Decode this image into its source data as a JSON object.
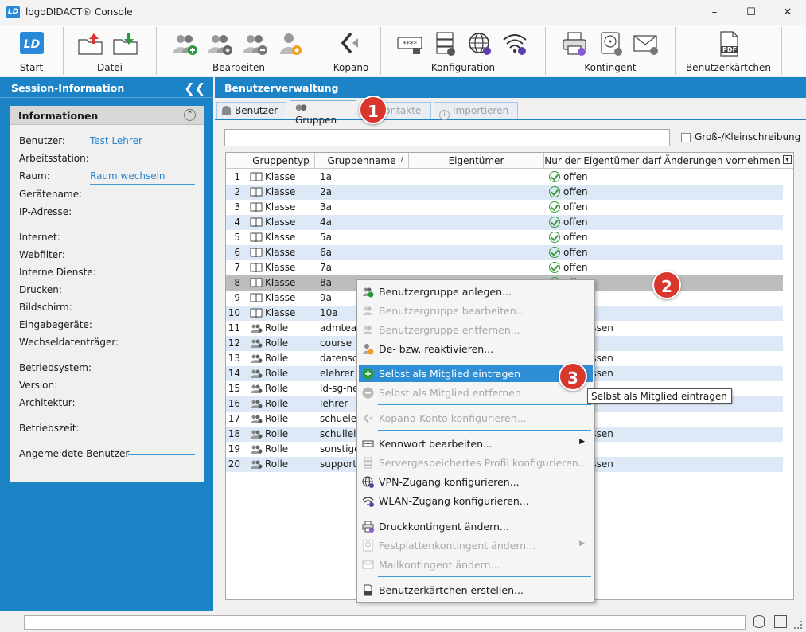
{
  "window": {
    "logo": "LD",
    "title": "logoDIDACT® Console"
  },
  "ribbon": {
    "groups": [
      {
        "label": "Start"
      },
      {
        "label": "Datei"
      },
      {
        "label": "Bearbeiten"
      },
      {
        "label": "Kopano"
      },
      {
        "label": "Konfiguration"
      },
      {
        "label": "Kontingent"
      },
      {
        "label": "Benutzerkärtchen"
      }
    ],
    "pdf_icon_text": "PDF"
  },
  "session": {
    "header": "Session-Information",
    "info_title": "Informationen",
    "labels": [
      "Benutzer:",
      "Arbeitsstation:",
      "Raum:",
      "Gerätename:",
      "IP-Adresse:",
      "Internet:",
      "Webfilter:",
      "Interne Dienste:",
      "Drucken:",
      "Bildschirm:",
      "Eingabegeräte:",
      "Wechseldatenträger:",
      "Betriebsystem:",
      "Version:",
      "Architektur:",
      "Betriebszeit:",
      "Angemeldete Benutzer"
    ],
    "benutzer_value": "Test Lehrer",
    "raum_value": "Raum wechseln"
  },
  "main": {
    "header": "Benutzerverwaltung",
    "tabs": [
      {
        "label": "Benutzer"
      },
      {
        "label": "Gruppen"
      },
      {
        "label": "Kontakte"
      },
      {
        "label": "Importieren"
      }
    ],
    "search_value": "",
    "case_label": "Groß-/Kleinschreibung",
    "columns": [
      "Gruppentyp",
      "Gruppenname",
      "Eigentümer",
      "Nur der Eigentümer darf Änderungen vornehmen"
    ],
    "rows": [
      {
        "n": "1",
        "type": "Klasse",
        "name": "1a",
        "owner": "",
        "status": "offen"
      },
      {
        "n": "2",
        "type": "Klasse",
        "name": "2a",
        "owner": "",
        "status": "offen"
      },
      {
        "n": "3",
        "type": "Klasse",
        "name": "3a",
        "owner": "",
        "status": "offen"
      },
      {
        "n": "4",
        "type": "Klasse",
        "name": "4a",
        "owner": "",
        "status": "offen"
      },
      {
        "n": "5",
        "type": "Klasse",
        "name": "5a",
        "owner": "",
        "status": "offen"
      },
      {
        "n": "6",
        "type": "Klasse",
        "name": "6a",
        "owner": "",
        "status": "offen"
      },
      {
        "n": "7",
        "type": "Klasse",
        "name": "7a",
        "owner": "",
        "status": "offen"
      },
      {
        "n": "8",
        "type": "Klasse",
        "name": "8a",
        "owner": "",
        "status": "offen"
      },
      {
        "n": "9",
        "type": "Klasse",
        "name": "9a",
        "owner": "",
        "status": ""
      },
      {
        "n": "10",
        "type": "Klasse",
        "name": "10a",
        "owner": "",
        "status": ""
      },
      {
        "n": "11",
        "type": "Rolle",
        "name": "admteac",
        "owner": "",
        "status": "ossen"
      },
      {
        "n": "12",
        "type": "Rolle",
        "name": "course",
        "owner": "",
        "status": ""
      },
      {
        "n": "13",
        "type": "Rolle",
        "name": "datenscl",
        "owner": "",
        "status": "ossen"
      },
      {
        "n": "14",
        "type": "Rolle",
        "name": "elehrer",
        "owner": "",
        "status": "ossen"
      },
      {
        "n": "15",
        "type": "Rolle",
        "name": "ld-sg-ne:",
        "owner": "",
        "status": ""
      },
      {
        "n": "16",
        "type": "Rolle",
        "name": "lehrer",
        "owner": "",
        "status": ""
      },
      {
        "n": "17",
        "type": "Rolle",
        "name": "schueler",
        "owner": "",
        "status": ""
      },
      {
        "n": "18",
        "type": "Rolle",
        "name": "schulleit",
        "owner": "",
        "status": "ossen"
      },
      {
        "n": "19",
        "type": "Rolle",
        "name": "sonstige",
        "owner": "",
        "status": ""
      },
      {
        "n": "20",
        "type": "Rolle",
        "name": "support",
        "owner": "",
        "status": "ossen"
      }
    ]
  },
  "context_menu": {
    "items": [
      {
        "label": "Benutzergruppe anlegen...",
        "disabled": false
      },
      {
        "label": "Benutzergruppe bearbeiten...",
        "disabled": true
      },
      {
        "label": "Benutzergruppe entfernen...",
        "disabled": true
      },
      {
        "label": "De- bzw. reaktivieren...",
        "disabled": false
      },
      {
        "label": "Selbst als Mitglied eintragen",
        "disabled": false,
        "highlighted": true
      },
      {
        "label": "Selbst als Mitglied entfernen",
        "disabled": true
      },
      {
        "label": "Kopano-Konto konfigurieren...",
        "disabled": true
      },
      {
        "label": "Kennwort bearbeiten...",
        "disabled": false,
        "submenu": true
      },
      {
        "label": "Servergespeichertes Profil konfigurieren...",
        "disabled": true
      },
      {
        "label": "VPN-Zugang konfigurieren...",
        "disabled": false
      },
      {
        "label": "WLAN-Zugang konfigurieren...",
        "disabled": false
      },
      {
        "label": "Druckkontingent ändern...",
        "disabled": false
      },
      {
        "label": "Festplattenkontingent ändern...",
        "disabled": true,
        "submenu": true
      },
      {
        "label": "Mailkontingent ändern...",
        "disabled": true
      },
      {
        "label": "Benutzerkärtchen erstellen...",
        "disabled": false
      }
    ]
  },
  "tooltip": "Selbst als Mitglied eintragen",
  "badges": [
    "1",
    "2",
    "3"
  ],
  "colors": {
    "accent": "#1c84c6",
    "highlight": "#2f8fd6",
    "badge": "#d9372e",
    "row_alt": "#dde9f6"
  }
}
